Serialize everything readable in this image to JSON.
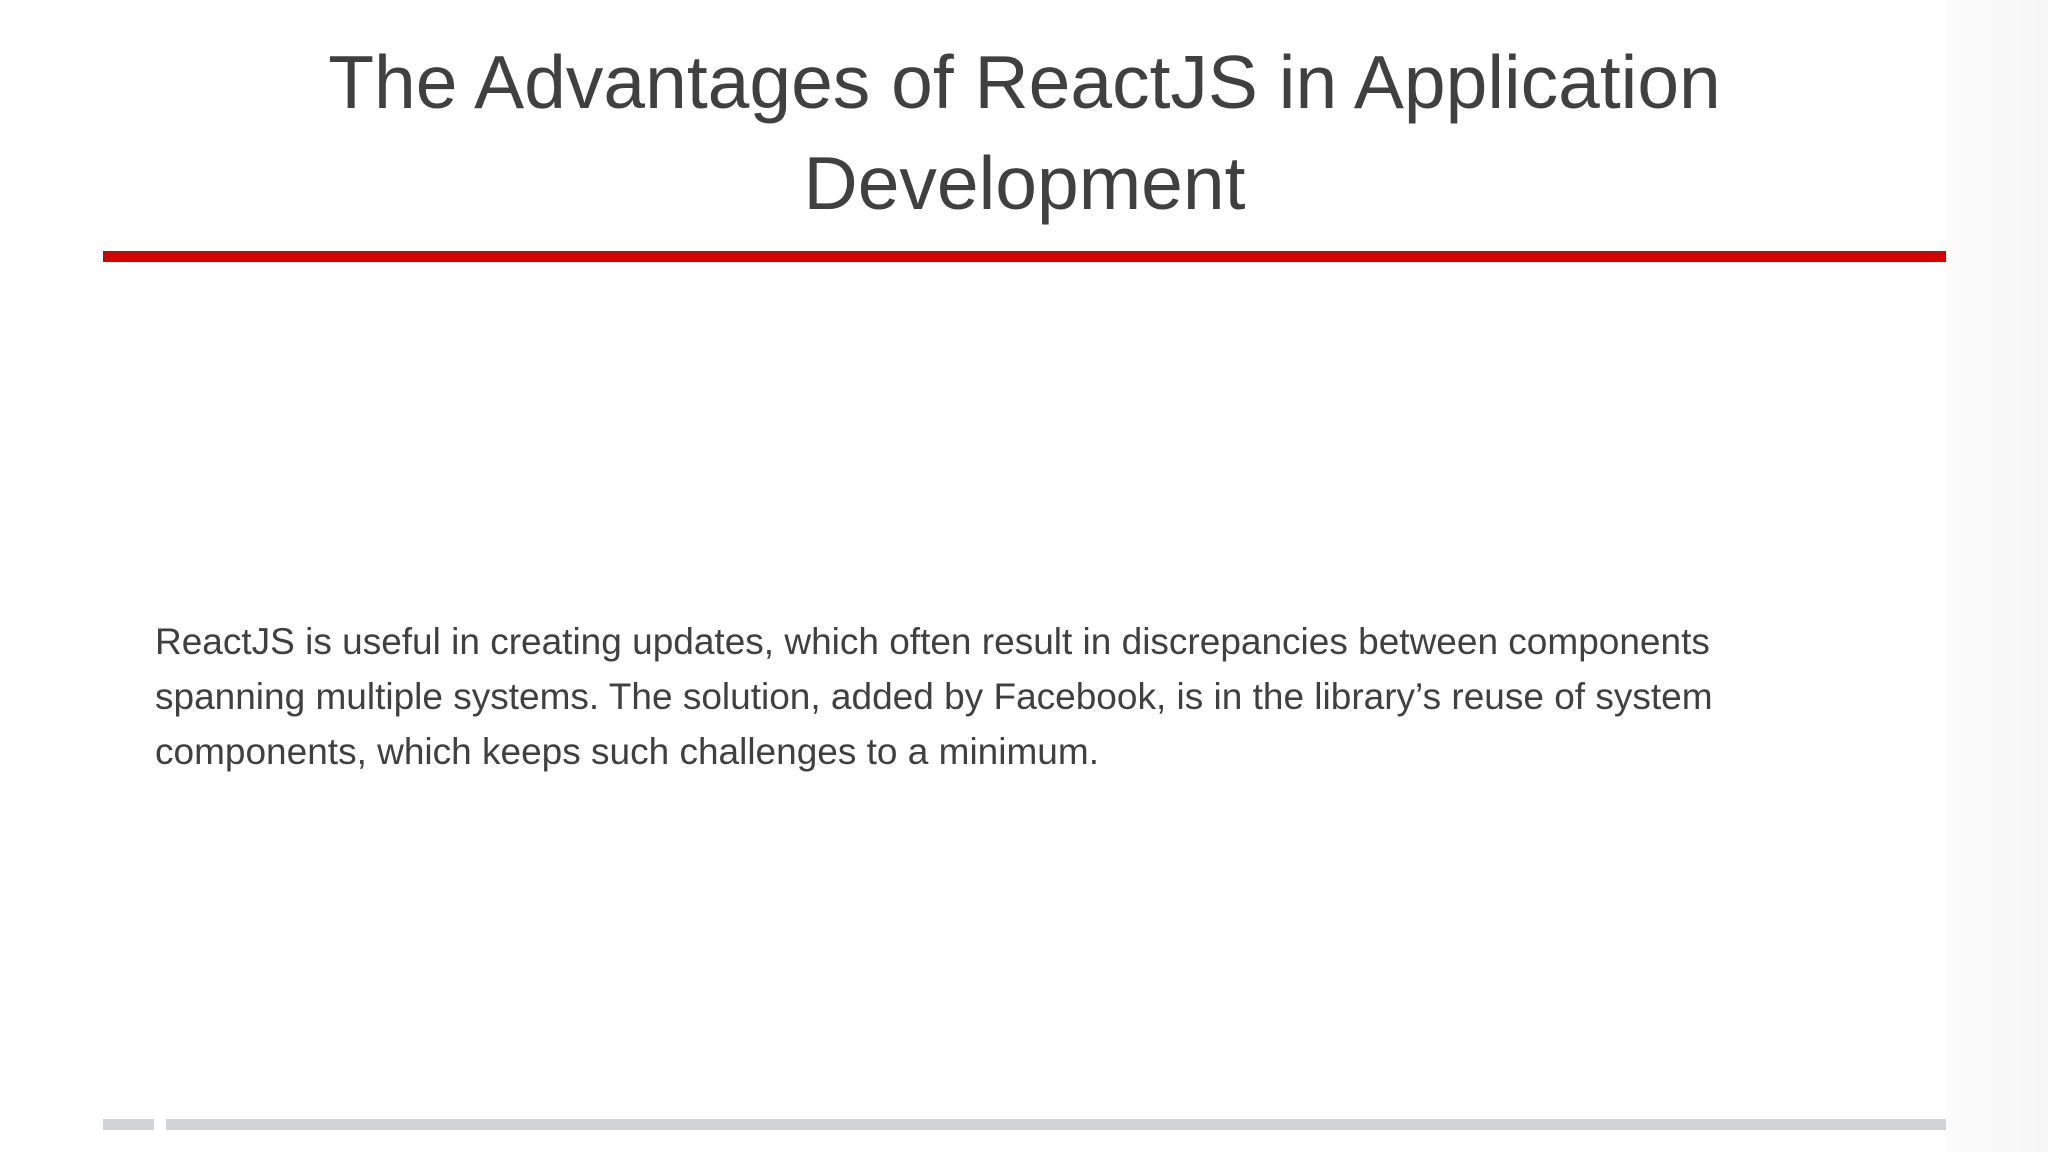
{
  "slide": {
    "title": "The Advantages of ReactJS in Application Development",
    "body": "ReactJS is useful in creating updates, which often result in discrepancies between components spanning multiple systems. The solution, added by Facebook, is in the library’s reuse of system components, which keeps such challenges to a minimum."
  },
  "colors": {
    "text": "#404040",
    "accent_rule": "#d50000",
    "footer_bar": "#d1d3d4"
  }
}
